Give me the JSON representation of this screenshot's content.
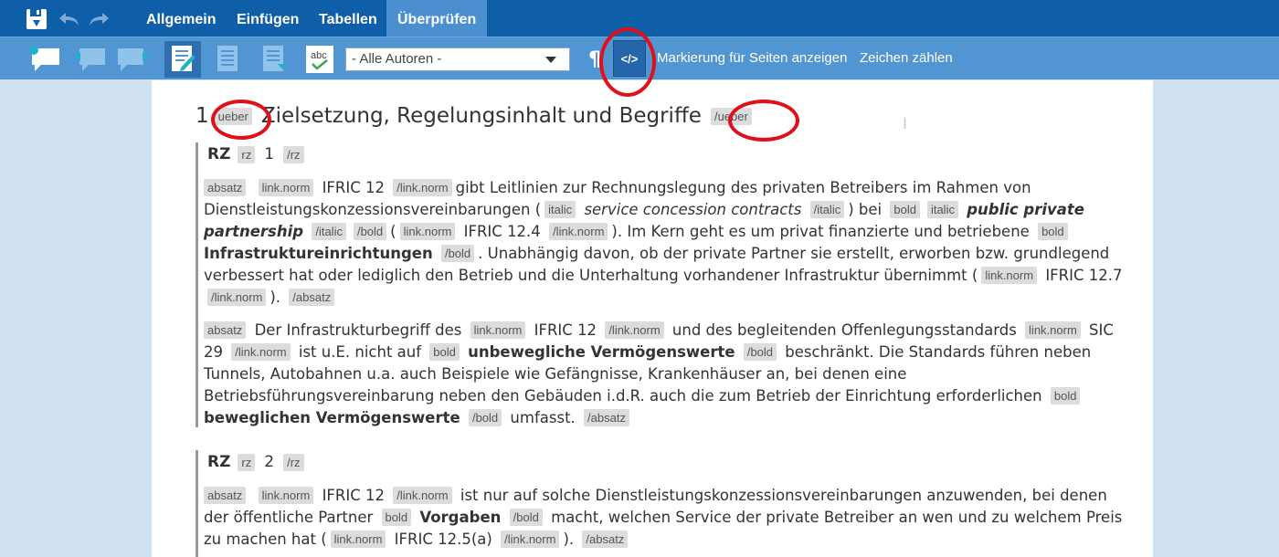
{
  "menu": {
    "tabs": [
      "Allgemein",
      "Einfügen",
      "Tabellen",
      "Überprüfen"
    ],
    "active_tab": "Überprüfen"
  },
  "toolbar": {
    "author_filter": "- Alle Autoren -",
    "code_button_label": "</>",
    "show_markup_label": "Markierung für Seiten anzeigen",
    "count_chars_label": "Zeichen zählen",
    "spell_label": "abc"
  },
  "document": {
    "heading": {
      "number": "1",
      "open_tag": "ueber",
      "text": "Zielsetzung, Regelungsinhalt und Begriffe",
      "close_tag": "/ueber"
    },
    "rz1": {
      "label": "RZ",
      "open_tag": "rz",
      "number": "1",
      "close_tag": "/rz"
    },
    "rz2": {
      "label": "RZ",
      "open_tag": "rz",
      "number": "2",
      "close_tag": "/rz"
    },
    "tags": {
      "absatz": "absatz",
      "absatz_close": "/absatz",
      "link_norm": "link.norm",
      "link_norm_close": "/link.norm",
      "italic": "italic",
      "italic_close": "/italic",
      "bold": "bold",
      "bold_close": "/bold"
    },
    "p1": {
      "ifric12": "IFRIC 12",
      "t1": "gibt Leitlinien zur Rechnungslegung des privaten Betreibers im Rahmen von Dienstleistungskonzessionsvereinbarungen (",
      "service": "service concession contracts",
      "t2": ") bei",
      "ppp": "public private partnership",
      "t3": "(",
      "ifric124": "IFRIC 12.4",
      "t4": "). Im Kern geht es um privat finanzierte und betriebene",
      "infra": "Infrastruktureinrichtungen",
      "t5": ". Unabhängig davon, ob der private Partner sie erstellt, erworben bzw. grundlegend verbessert hat oder lediglich den Betrieb und die Unterhaltung vorhandener Infrastruktur übernimmt (",
      "ifric127": "IFRIC 12.7",
      "t6": ")."
    },
    "p2": {
      "t1": "Der Infrastrukturbegriff des",
      "ifric12": "IFRIC 12",
      "t2": "und des begleitenden Offenlegungsstandards",
      "sic29": "SIC 29",
      "t3": "ist u.E. nicht auf",
      "unbeweglich": "unbewegliche Vermögenswerte",
      "t4": "beschränkt. Die Standards führen neben Tunnels, Autobahnen u.a. auch Beispiele wie Gefängnisse, Krankenhäuser an, bei denen eine Betriebsführungsvereinbarung neben den Gebäuden i.d.R. auch die zum Betrieb der Einrichtung erforderlichen",
      "beweglich": "beweglichen Vermögenswerte",
      "t5": "umfasst."
    },
    "p3": {
      "ifric12": "IFRIC 12",
      "t1": "ist nur auf solche Dienstleistungskonzessionsvereinbarungen anzuwenden, bei denen der öffentliche Partner",
      "vorgaben": "Vorgaben",
      "t2": "macht, welchen Service der private Betreiber an wen und zu welchem Preis zu machen hat (",
      "ifric125a": "IFRIC 12.5(a)",
      "t3": ")."
    }
  },
  "colors": {
    "menubar": "#0f5ea8",
    "toolbar": "#5295d3",
    "highlight_ring": "#e0101a",
    "tag_bg": "#dcdcdc"
  }
}
